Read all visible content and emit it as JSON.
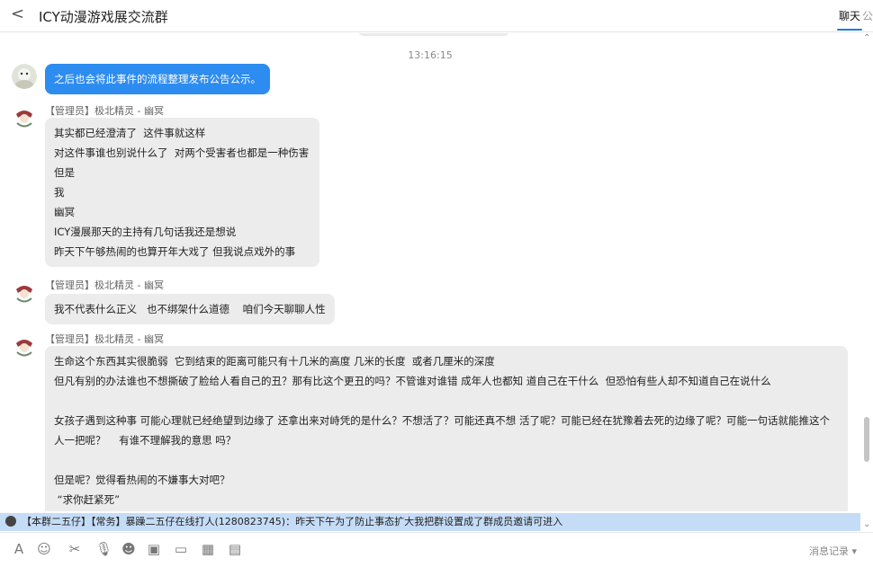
{
  "header": {
    "back_glyph": "<",
    "title": "ICY动漫游戏展交流群",
    "tab_chat": "聊天",
    "tab_next": "公"
  },
  "chat": {
    "timestamp": "13:16:15",
    "messages": [
      {
        "sender": "",
        "lines": "之后也会将此事件的流程整理发布公告公示。",
        "style": "blue"
      },
      {
        "sender": "【管理员】极北精灵 - 幽冥",
        "lines": "其实都已经澄清了  这件事就这样\n对这件事谁也别说什么了  对两个受害者也都是一种伤害\n但是\n我\n幽冥\nICY漫展那天的主持有几句话我还是想说\n昨天下午够热闹的也算开年大戏了 但我说点戏外的事",
        "style": "gray"
      },
      {
        "sender": "【管理员】极北精灵 - 幽冥",
        "lines": "我不代表什么正义   也不绑架什么道德    咱们今天聊聊人性",
        "style": "gray"
      },
      {
        "sender": "【管理员】极北精灵 - 幽冥",
        "lines": "生命这个东西其实很脆弱  它到结束的距离可能只有十几米的高度 几米的长度  或者几厘米的深度\n但凡有别的办法谁也不想撕破了脸给人看自己的丑？那有比这个更丑的吗？不管谁对谁错 成年人也都知 道自己在干什么  但恐怕有些人却不知道自己在说什么\n\n女孩子遇到这种事 可能心理就已经绝望到边缘了 还拿出来对峙凭的是什么？不想活了？可能还真不想 活了呢？可能已经在犹豫着去死的边缘了呢？可能一句话就能推这个人一把呢？    有谁不理解我的意思 吗？\n\n但是呢？觉得看热闹的不嫌事大对吧？\n “求你赶紧死”",
        "style": "gray"
      }
    ]
  },
  "notice": {
    "text": "【本群二五仔】【常务】暴躁二五仔在线打人(1280823745)：昨天下午为了防止事态扩大我把群设置成了群成员邀请可进入"
  },
  "toolbar": {
    "font_glyph": "A",
    "emoji_glyph": "☺",
    "scissors_glyph": "✂",
    "mic_glyph": "🎙",
    "sticker_glyph": "☻",
    "image_glyph": "▣",
    "folder_glyph": "▭",
    "screen_glyph": "▦",
    "calendar_glyph": "▤",
    "history_label": "消息记录 ▾"
  },
  "colors": {
    "accent": "#1e7be0",
    "blue_bubble": "#2d8cf0",
    "gray_bubble": "#ececec",
    "notice_bg": "#c5dcf7"
  }
}
